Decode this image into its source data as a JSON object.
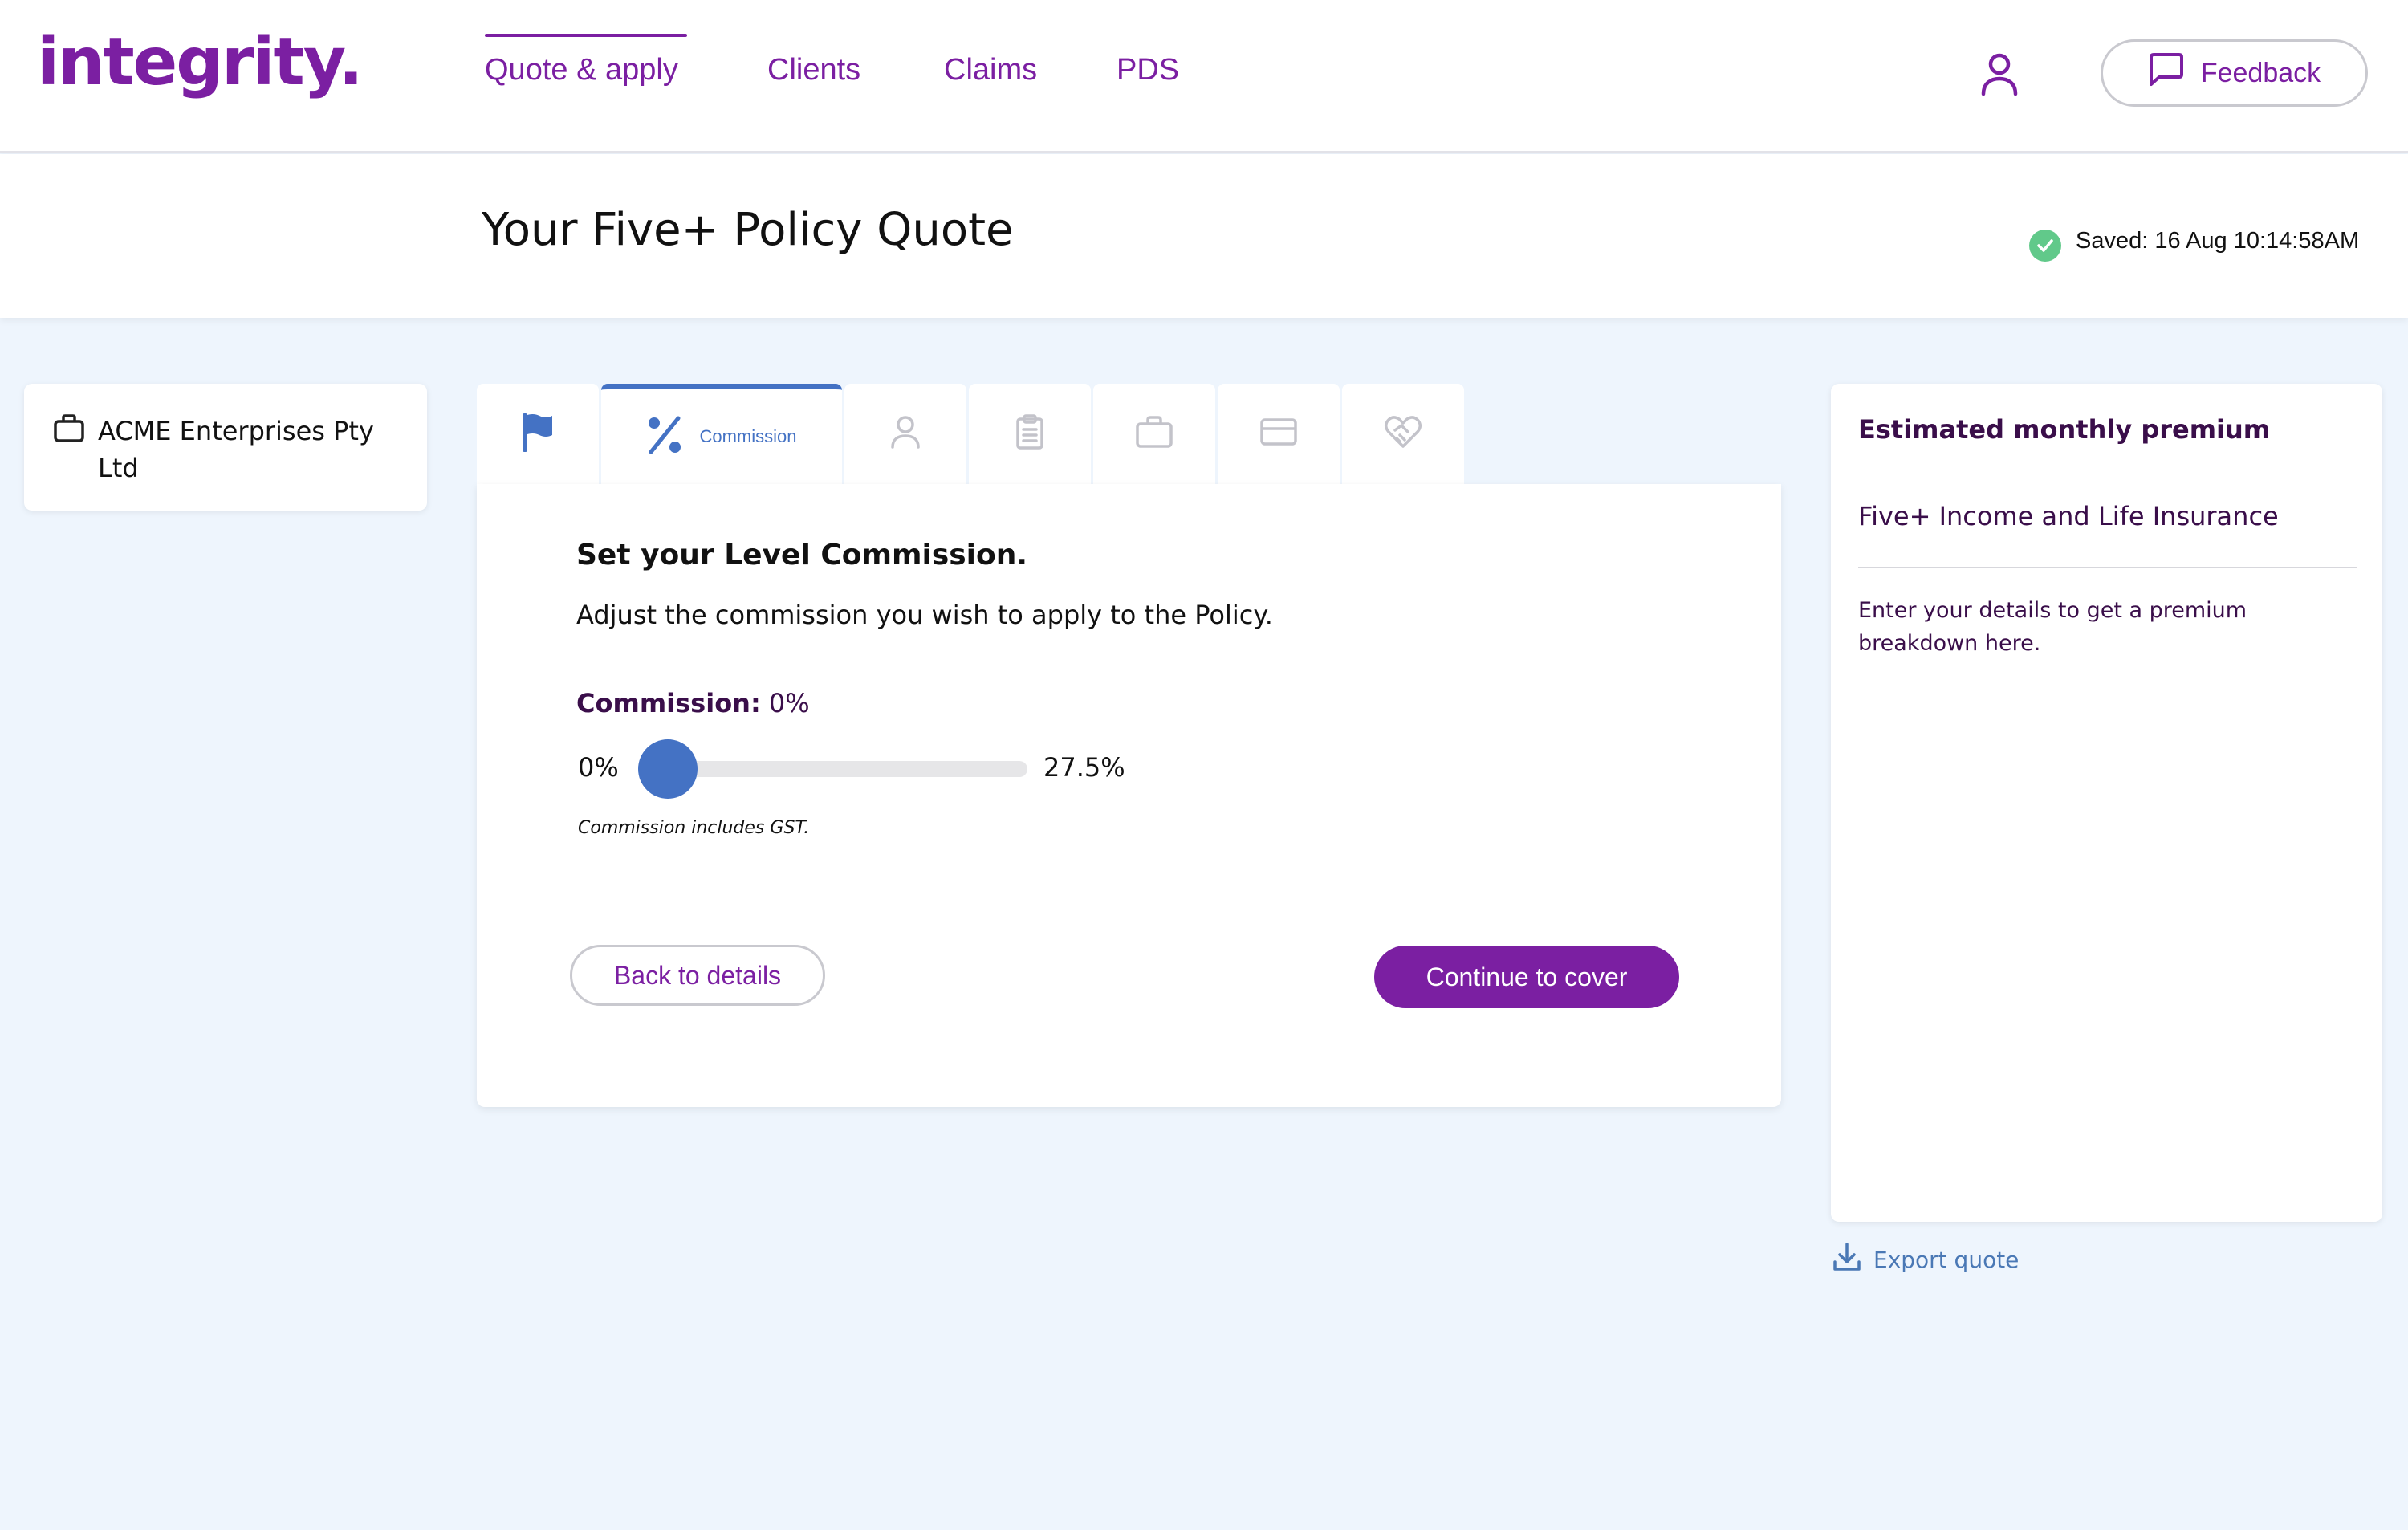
{
  "brand": {
    "logo_text": "integrity.",
    "accent": "#7b1fa2",
    "slider_color": "#4472c4"
  },
  "nav": {
    "items": [
      {
        "label": "Quote & apply",
        "active": true
      },
      {
        "label": "Clients"
      },
      {
        "label": "Claims"
      },
      {
        "label": "PDS"
      }
    ],
    "user_icon": "user-icon",
    "feedback_label": "Feedback",
    "feedback_icon": "message-square-icon"
  },
  "header": {
    "title": "Your Five+ Policy Quote",
    "saved_text": "Saved: 16 Aug 10:14:58AM",
    "saved_icon": "check-circle-icon"
  },
  "client": {
    "name": "ACME Enterprises Pty Ltd",
    "icon": "briefcase-icon"
  },
  "tabs": [
    {
      "icon": "flag-icon"
    },
    {
      "icon": "percent-icon",
      "label": "Commission",
      "active": true
    },
    {
      "icon": "person-icon"
    },
    {
      "icon": "clipboard-icon"
    },
    {
      "icon": "briefcase-icon"
    },
    {
      "icon": "credit-card-icon"
    },
    {
      "icon": "handshake-heart-icon"
    }
  ],
  "commission": {
    "heading": "Set your Level Commission.",
    "subtitle": "Adjust the commission you wish to apply to the Policy.",
    "label": "Commission:",
    "value_text": "0%",
    "value": 0,
    "min_label": "0%",
    "max_label": "27.5%",
    "max": 27.5,
    "note": "Commission includes GST."
  },
  "actions": {
    "back_label": "Back to details",
    "continue_label": "Continue to cover"
  },
  "premium": {
    "title": "Estimated monthly premium",
    "product": "Five+ Income and Life Insurance",
    "note": "Enter your details to get a premium breakdown here.",
    "export_label": "Export quote",
    "export_icon": "download-icon"
  }
}
